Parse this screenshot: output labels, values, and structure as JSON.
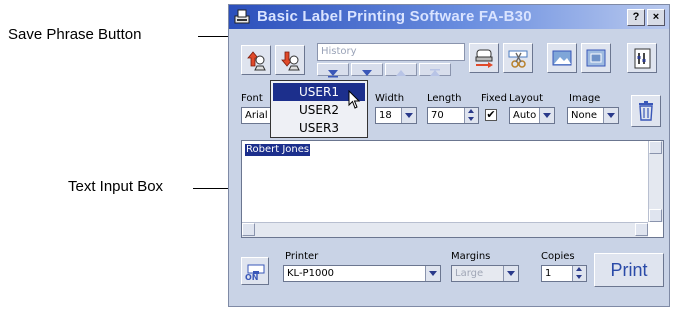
{
  "callouts": {
    "save_phrase": "Save Phrase Button",
    "text_input": "Text Input Box"
  },
  "window": {
    "title": "Basic Label Printing Software FA-B30",
    "help": "?",
    "close": "×"
  },
  "toolbar": {
    "history_placeholder": "History"
  },
  "settings": {
    "font_label": "Font",
    "font_value": "Arial",
    "width_label": "Width",
    "width_value": "18",
    "length_label": "Length",
    "length_value": "70",
    "fixed_label": "Fixed",
    "fixed_checked": "✔",
    "layout_label": "Layout",
    "layout_value": "Auto",
    "image_label": "Image",
    "image_value": "None"
  },
  "editor": {
    "text": "Robert Jones"
  },
  "phrase_menu": {
    "items": [
      "USER1",
      "USER2",
      "USER3"
    ],
    "selected": "USER1"
  },
  "bottom": {
    "on_label": "ON",
    "printer_label": "Printer",
    "printer_value": "KL-P1000",
    "margins_label": "Margins",
    "margins_value": "Large",
    "copies_label": "Copies",
    "copies_value": "1",
    "print_label": "Print"
  },
  "colors": {
    "window_bg": "#c9d3e6",
    "title_start": "#2b4fbb",
    "selection": "#1c2f8c",
    "print_text": "#2a4aa8"
  }
}
